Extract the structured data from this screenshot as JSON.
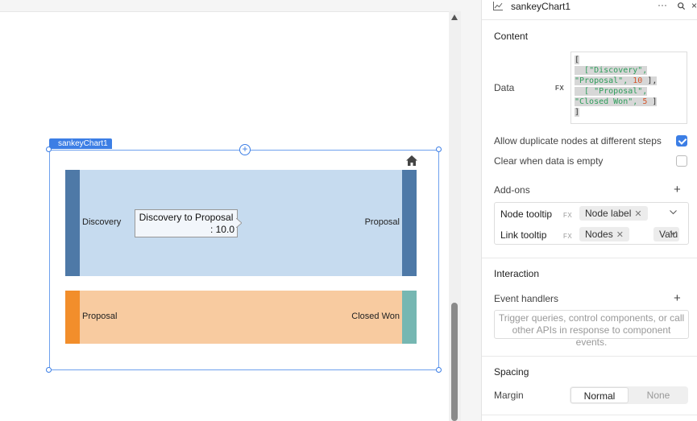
{
  "component": {
    "tag_label": "sankeyChart1"
  },
  "chart_data": {
    "type": "sankey",
    "flows": [
      {
        "from": "Discovery",
        "to": "Proposal",
        "value": 10
      },
      {
        "from": "Proposal",
        "to": "Closed Won",
        "value": 5
      }
    ],
    "nodes": [
      {
        "name": "Discovery",
        "color": "#4e79a7"
      },
      {
        "name": "Proposal",
        "color": "#4e79a7"
      },
      {
        "name": "Proposal",
        "color": "#f28e2b"
      },
      {
        "name": "Closed Won",
        "color": "#76b7b2"
      }
    ],
    "link_colors": [
      "#c6dbef",
      "#f8cba0"
    ],
    "tooltip": {
      "line1": "Discovery to Proposal",
      "line2": ": 10.0"
    }
  },
  "panel": {
    "title": "sankeyChart1",
    "more": "···",
    "close": "×",
    "content": {
      "title": "Content",
      "data_label": "Data",
      "fx": "FX",
      "code": {
        "open": "[",
        "row1_a": "[\"Discovery\",",
        "row1_b": "\"Proposal\",",
        "row1_num": "10",
        "row1_end": "],",
        "row2_a": "[ \"Proposal\",",
        "row2_b": "\"Closed Won\",",
        "row2_num": "5",
        "row2_end": "]",
        "close": "]"
      },
      "allow_duplicate_label": "Allow duplicate nodes at different steps",
      "allow_duplicate_checked": true,
      "clear_when_empty_label": "Clear when data is empty",
      "clear_when_empty_checked": false
    },
    "addons": {
      "title": "Add-ons",
      "add": "+",
      "rows": [
        {
          "label": "Node tooltip",
          "fx": "FX",
          "tag1": "Node label",
          "tag2": ""
        },
        {
          "label": "Link tooltip",
          "fx": "FX",
          "tag1": "Nodes",
          "tag2": "Valu"
        }
      ]
    },
    "interaction": {
      "title": "Interaction",
      "event_handlers_label": "Event handlers",
      "add": "+",
      "placeholder": "Trigger queries, control components, or call other APIs in response to component events."
    },
    "spacing": {
      "title": "Spacing",
      "margin_label": "Margin",
      "options": [
        "Normal",
        "None"
      ],
      "selected": "Normal"
    }
  }
}
